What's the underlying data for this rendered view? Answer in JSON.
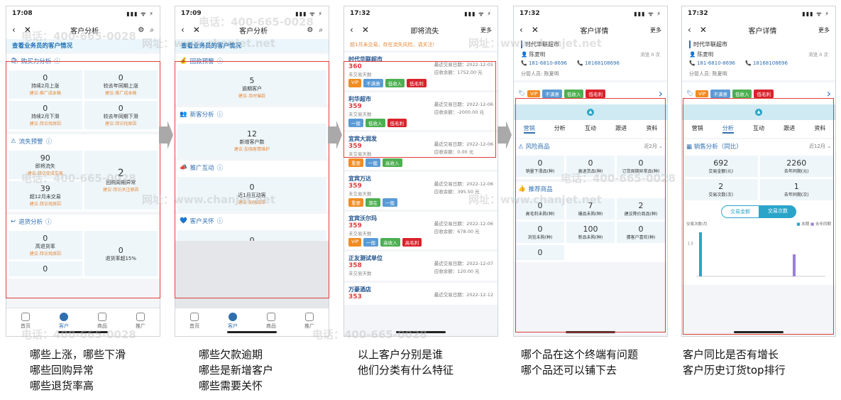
{
  "watermark": {
    "phone": "电话：400-665-0028",
    "url": "网址：www.chanjet.net"
  },
  "status_bar": {
    "signal": "▮▮▮ ᯤ ⚡"
  },
  "screen1": {
    "time": "17:08",
    "title": "客户分析",
    "band": "查看业务员的客户情况",
    "purchase": {
      "title": "购买力分析",
      "cells": [
        {
          "n": "0",
          "label": "持续2月上涨",
          "hint": "建议-推广成本稿"
        },
        {
          "n": "0",
          "label": "较去年同期上涨",
          "hint": "建议-推广成本稿"
        },
        {
          "n": "0",
          "label": "持续2月下滑",
          "hint": "建议-拜访找原因"
        },
        {
          "n": "0",
          "label": "较去年同期下滑",
          "hint": "建议-拜访找原因"
        }
      ]
    },
    "churn": {
      "title": "流失预警",
      "cells": [
        {
          "n": "90",
          "label": "即将流失",
          "hint": "建议-拜访促成交易"
        },
        {
          "n": "2",
          "label": "回购周期异常",
          "hint": "建议-拜访关注原因"
        },
        {
          "n": "39",
          "label": "超12月未交易",
          "hint": "建议-拜访找原因"
        }
      ]
    },
    "returns": {
      "title": "退货分析",
      "cells": [
        {
          "n": "0",
          "label": "高退货率",
          "hint": "建议-拜访找原因"
        },
        {
          "n": "0",
          "label": "退货率超15%",
          "hint": ""
        },
        {
          "n": "0",
          "label": "",
          "hint": ""
        }
      ]
    }
  },
  "screen2": {
    "time": "17:09",
    "title": "客户分析",
    "band": "查看业务员的客户情况",
    "sections": [
      {
        "title": "回款预警",
        "n": "5",
        "label": "逾期客户",
        "hint": "建议-及时催款"
      },
      {
        "title": "新客分析",
        "n": "12",
        "label": "新增客户数",
        "hint": "建议-加强客情维护"
      },
      {
        "title": "推广互动",
        "n": "0",
        "label": "近1月互动客",
        "hint": "建议-加强成单"
      },
      {
        "title": "客户关怀",
        "n": "0",
        "label": "近3天生日",
        "hint": "建议-拜访生日祝福"
      }
    ]
  },
  "tabbar": [
    "首页",
    "客户",
    "商品",
    "推广"
  ],
  "screen3": {
    "time": "17:32",
    "title": "即将流失",
    "more": "更多",
    "warning": "超1月未交易，存在流失风险，请关注!",
    "customers": [
      {
        "name": "时代华联超市",
        "v": "360",
        "days": "未交易天数",
        "date_label": "最近交易日期：",
        "date": "2022-12-05",
        "bal_label": "应收余额：",
        "bal": "1752.00 元",
        "tags": [
          "VIP",
          "不满意",
          "低收入",
          "低毛利"
        ]
      },
      {
        "name": "利华超市",
        "v": "359",
        "days": "未交易天数",
        "date_label": "最近交易日期：",
        "date": "2022-12-06",
        "bal_label": "应收余额：",
        "bal": "-2000.00 元",
        "tags": [
          "一般",
          "低收入",
          "低毛利"
        ]
      },
      {
        "name": "宜宾大润发",
        "v": "359",
        "days": "未交易天数",
        "date_label": "最近交易日期：",
        "date": "2022-12-06",
        "bal_label": "应收余额：",
        "bal": "0.00 元",
        "tags": [
          "重要",
          "一般",
          "高收入"
        ]
      },
      {
        "name": "宜宾万达",
        "v": "359",
        "days": "未交易天数",
        "date_label": "最近交易日期：",
        "date": "2022-12-06",
        "bal_label": "应收余额：",
        "bal": "395.50 元",
        "tags": [
          "重要",
          "潜在",
          "一般"
        ]
      },
      {
        "name": "宜宾沃尔玛",
        "v": "359",
        "days": "未交易天数",
        "date_label": "最近交易日期：",
        "date": "2022-12-06",
        "bal_label": "应收余额：",
        "bal": "678.00 元",
        "tags": [
          "VIP",
          "一般",
          "高收入",
          "高毛利"
        ]
      },
      {
        "name": "正友测试单位",
        "v": "358",
        "days": "未交易天数",
        "date_label": "最近交易日期：",
        "date": "2022-12-07",
        "bal_label": "应收余额：",
        "bal": "120.00 元",
        "tags": []
      },
      {
        "name": "万豪酒店",
        "v": "353",
        "days": "",
        "date_label": "最近交易日期：",
        "date": "2022-12-12",
        "bal_label": "",
        "bal": "",
        "tags": []
      }
    ]
  },
  "screen4": {
    "time": "17:32",
    "title": "客户详情",
    "more": "更多",
    "name": "时代华联超市",
    "contact": "陈夏明",
    "visit": "浏览 0 次",
    "phone1": "181-6810-8696",
    "phone2": "18168108696",
    "manager": "分管人员: 陈夏明",
    "tags": [
      "VIP",
      "不满意",
      "低收入",
      "低毛利"
    ],
    "tabs": [
      "营销",
      "分析",
      "互动",
      "跟进",
      "资料"
    ],
    "risk": {
      "title": "风险商品",
      "period": "近2月",
      "cells": [
        {
          "n": "0",
          "label": "销量下滑品(种)"
        },
        {
          "n": "0",
          "label": "高退货品(种)"
        },
        {
          "n": "0",
          "label": "订货周期异常品(种)"
        }
      ]
    },
    "rec": {
      "title": "推荐商品",
      "cells": [
        {
          "n": "0",
          "label": "高毛利未购(种)"
        },
        {
          "n": "7",
          "label": "爆品未购(种)"
        },
        {
          "n": "2",
          "label": "建议降价商品(种)"
        },
        {
          "n": "0",
          "label": "浏览未购(种)"
        },
        {
          "n": "100",
          "label": "新品未购(种)"
        },
        {
          "n": "0",
          "label": "猜客户喜欢(种)"
        },
        {
          "n": "0",
          "label": ""
        }
      ]
    }
  },
  "screen5": {
    "time": "17:32",
    "title": "客户详情",
    "more": "更多",
    "name": "时代华联超市",
    "contact": "陈夏明",
    "visit": "浏览 0 次",
    "phone1": "181-6810-8696",
    "phone2": "18168108696",
    "manager": "分管人员: 陈夏明",
    "tags": [
      "VIP",
      "不满意",
      "低收入",
      "低毛利"
    ],
    "tabs": [
      "营销",
      "分析",
      "互动",
      "跟进",
      "资料"
    ],
    "sales": {
      "title": "销售分析（同比）",
      "period": "近12月",
      "cells": [
        {
          "n": "692",
          "label": "交易金额(元)"
        },
        {
          "n": "2260",
          "label": "去年同期(元)"
        },
        {
          "n": "2",
          "label": "交易次数(次)"
        },
        {
          "n": "1",
          "label": "去年同期(次)"
        }
      ]
    },
    "toggle": [
      "交易金额",
      "交易次数"
    ],
    "chart_ylabel": "交易次数/月",
    "legend": [
      "本期",
      "去年同期"
    ],
    "y_tick": "1.5"
  },
  "chart_data": {
    "type": "bar",
    "ylabel": "交易次数/月",
    "series": [
      {
        "name": "本期",
        "values": [
          2,
          0
        ]
      },
      {
        "name": "去年同期",
        "values": [
          0,
          1
        ]
      }
    ],
    "categories": [
      "",
      ""
    ],
    "legend": "top-right"
  },
  "captions": [
    [
      "哪些上涨，哪些下滑",
      "哪些回购异常",
      "哪些退货率高"
    ],
    [
      "哪些欠款逾期",
      "哪些是新增客户",
      "哪些需要关怀"
    ],
    [
      "以上客户分别是谁",
      "他们分类有什么特征"
    ],
    [
      "哪个品在这个终端有问题",
      "哪个品还可以铺下去"
    ],
    [
      "客户同比是否有增长",
      "客户历史订货top排行"
    ]
  ],
  "colors": {
    "accent": "#2f6fb0",
    "highlight": "#e23c3c",
    "tile": "#eef6fa"
  }
}
